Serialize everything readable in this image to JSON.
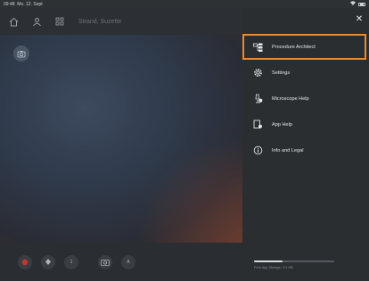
{
  "status": {
    "time": "09:48",
    "date": "Mo. 12. Sept"
  },
  "topbar": {
    "user_name": "Strand, Suzette"
  },
  "bottombar": {
    "btn_label_a": "1",
    "btn_label_b": "A"
  },
  "panel": {
    "items": [
      {
        "label": "Procedure Architect",
        "icon": "procedure-architect-icon"
      },
      {
        "label": "Settings",
        "icon": "gear-icon"
      },
      {
        "label": "Microscope Help",
        "icon": "microscope-help-icon"
      },
      {
        "label": "App Help",
        "icon": "app-help-icon"
      },
      {
        "label": "Info and Legal",
        "icon": "info-icon"
      }
    ],
    "storage_label": "Free App Storage: 3.4 GB",
    "storage_used_fraction": 0.35
  },
  "colors": {
    "accent": "#e88a2d",
    "record": "#c0392b"
  }
}
